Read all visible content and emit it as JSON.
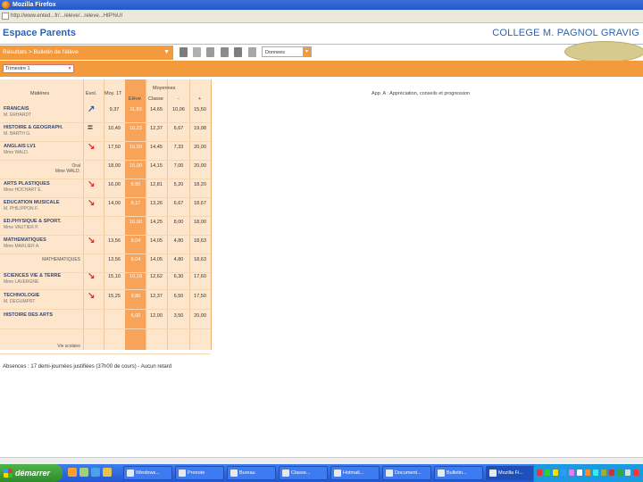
{
  "window": {
    "title": "Mozilla Firefox"
  },
  "address": {
    "url": "http://www.ented...fr/.../eleve/...releve...HtP%UI"
  },
  "site": {
    "title": "Espace Parents",
    "school": "COLLEGE M. PAGNOL GRAVIG"
  },
  "breadcrumb": {
    "text": "Résultats > Bulletin de l'élève"
  },
  "toolbar": {
    "select_value": "Donnees"
  },
  "period": {
    "value": "Trimestre 1"
  },
  "table": {
    "headers": {
      "matieres": "Matières",
      "evol": "Evol.",
      "moy": "Moy. 1T",
      "moyennes": "Moyennes",
      "eleve": "Elève",
      "classe": "Classe",
      "minus": "-",
      "plus": "+",
      "app": "App. A : Appréciation, conseils et progression"
    },
    "rows": [
      {
        "subject": "FRANCAIS",
        "teacher": "M. ERHARDT",
        "arrow": "↗",
        "arrow_color": "#2a63b8",
        "moy": "9,37",
        "eleve": "11,83",
        "classe": "14,65",
        "min": "10,06",
        "max": "15,50"
      },
      {
        "subject": "HISTOIRE & GEOGRAPH.",
        "teacher": "M. BARTH G.",
        "arrow": "=",
        "arrow_color": "#222222",
        "moy": "10,49",
        "eleve": "10,23",
        "classe": "12,37",
        "min": "6,67",
        "max": "19,08"
      },
      {
        "subject": "ANGLAIS LV1",
        "teacher": "Mme WALD.",
        "arrow": "↘",
        "arrow_color": "#d9342b",
        "moy": "17,50",
        "eleve": "15,50",
        "classe": "14,45",
        "min": "7,33",
        "max": "20,00"
      },
      {
        "subject": "Oral",
        "teacher": "Mme WALD.",
        "sub": true,
        "arrow": "",
        "arrow_color": "#222222",
        "moy": "18,00",
        "eleve": "15,00",
        "classe": "14,15",
        "min": "7,00",
        "max": "20,00"
      },
      {
        "subject": "ARTS PLASTIQUES",
        "teacher": "Mme HOCHART E.",
        "arrow": "↘",
        "arrow_color": "#d9342b",
        "moy": "16,00",
        "eleve": "6,50",
        "classe": "12,81",
        "min": "5,20",
        "max": "18,20"
      },
      {
        "subject": "EDUCATION MUSICALE",
        "teacher": "M. PHILIPPON F.",
        "arrow": "↘",
        "arrow_color": "#d9342b",
        "moy": "14,00",
        "eleve": "8,17",
        "classe": "13,26",
        "min": "6,67",
        "max": "18,67"
      },
      {
        "subject": "ED.PHYSIQUE & SPORT.",
        "teacher": "Mme VAUTIER P.",
        "arrow": "",
        "arrow_color": "#222222",
        "moy": "",
        "eleve": "16,00",
        "classe": "14,25",
        "min": "8,00",
        "max": "18,00"
      },
      {
        "subject": "MATHEMATIQUES",
        "teacher": "Mme MARLIER A.",
        "arrow": "↘",
        "arrow_color": "#d9342b",
        "moy": "13,56",
        "eleve": "8,04",
        "classe": "14,05",
        "min": "4,80",
        "max": "18,63"
      },
      {
        "subject": "MATHEMATIQUES",
        "teacher": "",
        "sub": true,
        "arrow": "",
        "arrow_color": "#222222",
        "moy": "13,56",
        "eleve": "8,04",
        "classe": "14,05",
        "min": "4,80",
        "max": "18,63"
      },
      {
        "subject": "SCIENCES VIE & TERRE",
        "teacher": "Mme LAVERGNE",
        "arrow": "↘",
        "arrow_color": "#d9342b",
        "moy": "15,10",
        "eleve": "10,18",
        "classe": "12,62",
        "min": "6,30",
        "max": "17,60"
      },
      {
        "subject": "TECHNOLOGIE",
        "teacher": "M. DEGUMPRT",
        "arrow": "↘",
        "arrow_color": "#d9342b",
        "moy": "15,25",
        "eleve": "9,80",
        "classe": "12,37",
        "min": "6,50",
        "max": "17,50"
      },
      {
        "subject": "HISTOIRE DES ARTS",
        "teacher": "",
        "arrow": "",
        "arrow_color": "#222222",
        "moy": "",
        "eleve": "6,00",
        "classe": "12,00",
        "min": "3,50",
        "max": "20,00"
      },
      {
        "subject": "",
        "teacher": "Vie scolaire",
        "sub": true,
        "arrow": "",
        "arrow_color": "#222222",
        "moy": "",
        "eleve": "",
        "classe": "",
        "min": "",
        "max": ""
      }
    ]
  },
  "absences": {
    "text": "Absences : 17 demi-journées justifiées (37h00 de cours) - Aucun retard"
  },
  "taskbar": {
    "start": "démarrer",
    "tasks": [
      "Windows...",
      "Pronote",
      "Bureau",
      "Classe...",
      "Hotmail...",
      "Document...",
      "Bulletin...",
      "Mozilla Fi..."
    ]
  },
  "colors": {
    "accent": "#f39a3d",
    "header_blue": "#2a63b8",
    "eleve_column": "#f7a35a",
    "table_bg": "#fde6cb"
  }
}
